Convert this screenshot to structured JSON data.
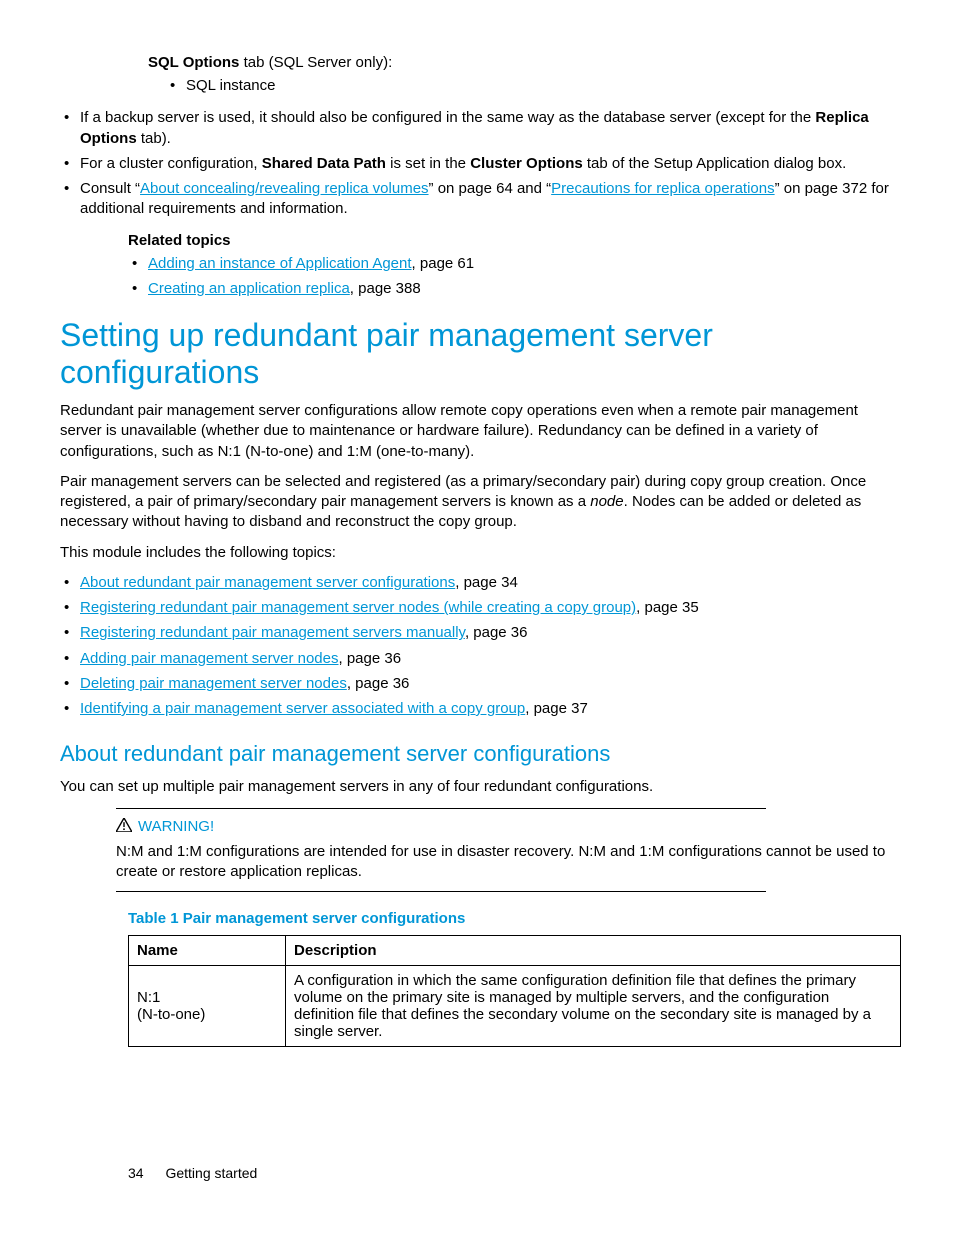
{
  "top": {
    "sql_options_head_bold": "SQL Options",
    "sql_options_head_rest": " tab (SQL Server only):",
    "sql_sub_bullet": "SQL instance",
    "bullet_backup_1": "If a backup server is used, it should also be configured in the same way as the database server (except for the ",
    "bullet_backup_bold": "Replica Options",
    "bullet_backup_2": " tab).",
    "bullet_cluster_1": "For a cluster configuration, ",
    "bullet_cluster_bold1": "Shared Data Path",
    "bullet_cluster_2": " is set in the ",
    "bullet_cluster_bold2": "Cluster Options",
    "bullet_cluster_3": " tab of the Setup Application dialog box.",
    "bullet_consult_1": "Consult “",
    "bullet_consult_link1": "About concealing/revealing replica volumes",
    "bullet_consult_2": "” on page 64 and “",
    "bullet_consult_link2": "Precautions for replica operations",
    "bullet_consult_3": "” on page 372 for additional requirements and information."
  },
  "related": {
    "heading": "Related topics",
    "items": [
      {
        "link": "Adding an instance of Application Agent",
        "tail": ", page 61"
      },
      {
        "link": "Creating an application replica",
        "tail": ", page 388"
      }
    ]
  },
  "h1": "Setting up redundant pair management server configurations",
  "p1": "Redundant pair management server configurations allow remote copy operations even when a remote pair management server is unavailable (whether due to maintenance or hardware failure). Redundancy can be defined in a variety of configurations, such as N:1 (N-to-one) and 1:M (one-to-many).",
  "p2_a": "Pair management servers can be selected and registered (as a primary/secondary pair) during copy group creation. Once registered, a pair of primary/secondary pair management servers is known as a ",
  "p2_i": "node",
  "p2_b": ". Nodes can be added or deleted as necessary without having to disband and reconstruct the copy group.",
  "p3": "This module includes the following topics:",
  "topics": [
    {
      "link": "About redundant pair management server configurations",
      "tail": ", page 34"
    },
    {
      "link": "Registering redundant pair management server nodes (while creating a copy group)",
      "tail": ", page 35"
    },
    {
      "link": "Registering redundant pair management servers manually",
      "tail": ", page 36"
    },
    {
      "link": "Adding pair management server nodes",
      "tail": ", page 36"
    },
    {
      "link": "Deleting pair management server nodes",
      "tail": ", page 36"
    },
    {
      "link": "Identifying a pair management server associated with a copy group",
      "tail": ", page 37"
    }
  ],
  "h2": "About redundant pair management server configurations",
  "p4": "You can set up multiple pair management servers in any of four redundant configurations.",
  "warning_label": "WARNING!",
  "warning_body": "N:M and 1:M configurations are intended for use in disaster recovery. N:M and 1:M configurations cannot be used to create or restore application replicas.",
  "table_title": "Table 1 Pair management server configurations",
  "table": {
    "col1": "Name",
    "col2": "Description",
    "row1_name_line1": "N:1",
    "row1_name_line2": "(N-to-one)",
    "row1_desc": "A configuration in which the same configuration definition file that defines the primary volume on the primary site is managed by multiple servers, and the configuration definition file that defines the secondary volume on the secondary site is managed by a single server."
  },
  "footer_page": "34",
  "footer_section": "Getting started"
}
